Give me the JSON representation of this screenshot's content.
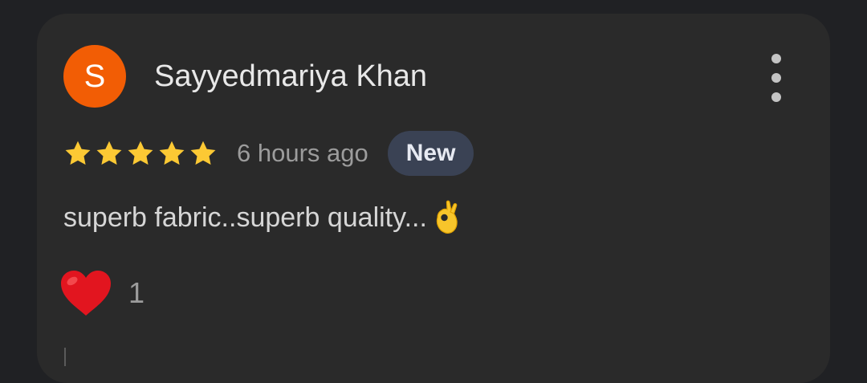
{
  "review": {
    "avatar_initial": "S",
    "avatar_color": "#f25d05",
    "reviewer_name": "Sayyedmariya Khan",
    "rating": 5,
    "rating_max": 5,
    "timestamp": "6 hours ago",
    "badge": "New",
    "text": "superb fabric..superb quality...",
    "text_emoji_icon": "ok-hand-icon",
    "reaction_icon": "red-heart-icon",
    "reaction_count": "1",
    "menu_icon": "more-vert-icon"
  }
}
